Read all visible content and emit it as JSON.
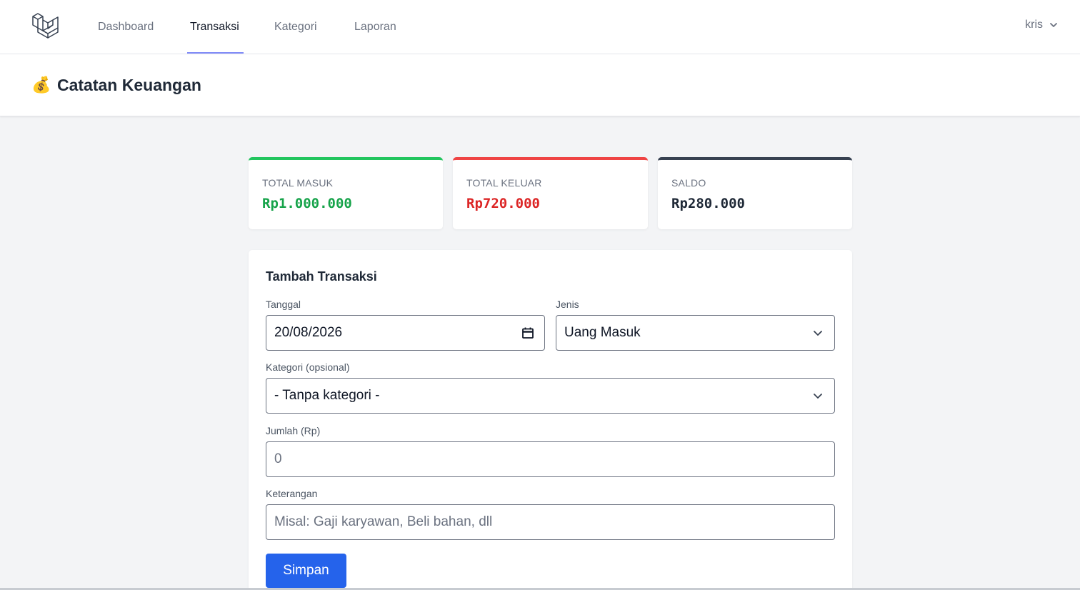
{
  "nav": {
    "links": [
      "Dashboard",
      "Transaksi",
      "Kategori",
      "Laporan"
    ],
    "active": "Transaksi",
    "user": "kris",
    "accent": "#818cf8"
  },
  "header": {
    "icon": "💰",
    "title": "Catatan Keuangan"
  },
  "summary": [
    {
      "label": "TOTAL MASUK",
      "value": "Rp1.000.000",
      "color": "#16a34a"
    },
    {
      "label": "TOTAL KELUAR",
      "value": "Rp720.000",
      "color": "#dc2626"
    },
    {
      "label": "SALDO",
      "value": "Rp280.000",
      "color": "#1f2937"
    }
  ],
  "form": {
    "title": "Tambah Transaksi",
    "tanggal": {
      "label": "Tanggal",
      "value": "20/08/2026"
    },
    "jenis": {
      "label": "Jenis",
      "value": "Uang Masuk"
    },
    "kategori": {
      "label": "Kategori (opsional)",
      "value": "- Tanpa kategori -"
    },
    "jumlah": {
      "label": "Jumlah (Rp)",
      "placeholder": "0"
    },
    "keterangan": {
      "label": "Keterangan",
      "placeholder": "Misal: Gaji karyawan, Beli bahan, dll"
    },
    "submit": "Simpan"
  },
  "colors": {
    "primary_button": "#2563eb",
    "income": "#22c55e",
    "expense": "#ef4444",
    "balance": "#374151"
  }
}
